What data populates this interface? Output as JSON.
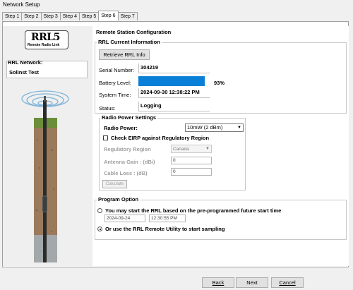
{
  "window": {
    "title": "Network Setup"
  },
  "tabs": [
    "Step 1",
    "Step 2",
    "Step 3",
    "Step 4",
    "Step 5",
    "Step 6",
    "Step 7"
  ],
  "active_tab": "Step 6",
  "left": {
    "logo_big": "RRL5",
    "logo_small": "Remote Radio Link",
    "network_label": "RRL Network:",
    "network_value": "Solinst Test"
  },
  "section_title": "Remote Station Configuration",
  "rrl_info": {
    "group_title": "RRL Current Information",
    "retrieve_button": "Retrieve RRL Info",
    "serial_label": "Serial Number:",
    "serial_value": "304219",
    "battery_label": "Battery Level:",
    "battery_percent": 93,
    "battery_text": "93%",
    "time_label": "System Time:",
    "time_value": "2024-09-30 12:38:22 PM",
    "status_label": "Status:",
    "status_value": "Logging"
  },
  "radio_power": {
    "group_title": "Radio Power Settings",
    "power_label": "Radio Power:",
    "power_value": "10mW (2 dBm)",
    "eirp_label": "Check EIRP against Regulatory Region",
    "region_label": "Regulatory Region",
    "region_value": "Canada",
    "antenna_label": "Antenna Gain : (dBi)",
    "antenna_value": "0",
    "cable_label": "Cable Loss : (dB)",
    "cable_value": "0",
    "calculate_button": "Calculate"
  },
  "program_option": {
    "group_title": "Program Option",
    "option1_label": "You may start the RRL based on the pre-programmed future start time",
    "start_date": "2024-09-24",
    "start_time": "12:30:55 PM",
    "option2_label": "Or use the RRL Remote Utility to start sampling",
    "selected": "option2"
  },
  "footer": {
    "back": "Back",
    "next": "Next",
    "cancel": "Cancel"
  }
}
